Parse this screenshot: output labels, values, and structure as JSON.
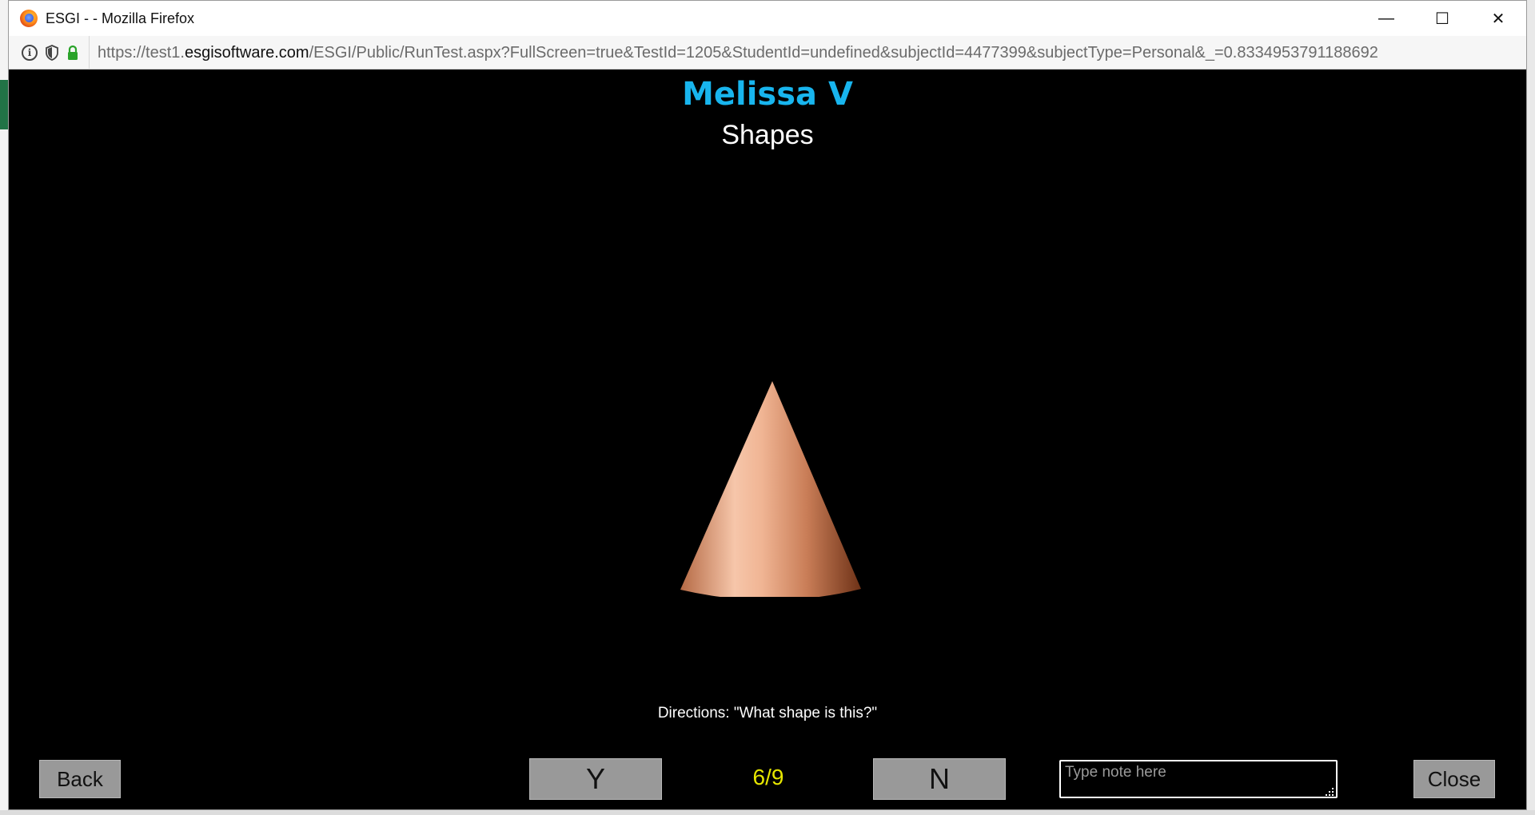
{
  "window": {
    "title": "ESGI - - Mozilla Firefox",
    "controls": {
      "minimize": "—",
      "maximize": "☐",
      "close": "✕"
    }
  },
  "address_bar": {
    "url_prefix": "https://test1.",
    "url_domain": "esgisoftware.com",
    "url_path": "/ESGI/Public/RunTest.aspx?FullScreen=true&TestId=1205&StudentId=undefined&subjectId=4477399&subjectType=Personal&_=0.8334953791188692",
    "icons": [
      "info-icon",
      "shield-icon",
      "lock-icon"
    ]
  },
  "test": {
    "student_name": "Melissa V",
    "subject": "Shapes",
    "shape_icon": "cone-icon",
    "directions": "Directions: \"What shape is this?\"",
    "progress": "6/9",
    "current_question": 6,
    "total_questions": 9
  },
  "controls": {
    "back_label": "Back",
    "yes_label": "Y",
    "no_label": "N",
    "close_label": "Close",
    "note_placeholder": "Type note here",
    "note_value": ""
  },
  "colors": {
    "name_accent": "#18b5ee",
    "progress_text": "#e6e600",
    "button_bg": "#999999",
    "background": "#000000"
  }
}
